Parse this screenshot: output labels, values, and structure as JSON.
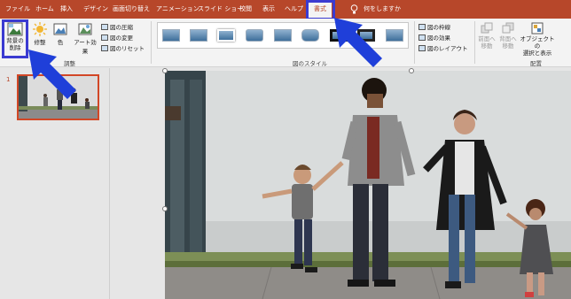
{
  "tabs": [
    {
      "label": "ファイル"
    },
    {
      "label": "ホーム"
    },
    {
      "label": "挿入"
    },
    {
      "label": "デザイン"
    },
    {
      "label": "画面切り替え"
    },
    {
      "label": "アニメーション"
    },
    {
      "label": "スライド ショー"
    },
    {
      "label": "校閲"
    },
    {
      "label": "表示"
    },
    {
      "label": "ヘルプ"
    },
    {
      "label": "書式"
    }
  ],
  "tell_me": "何をしますか",
  "ribbon": {
    "remove_bg": "背景の\n削除",
    "corrections": "修整",
    "color": "色",
    "artistic": "アート効果",
    "compress": "図の圧縮",
    "change": "図の変更",
    "reset": "図のリセット",
    "adjust_group": "調整",
    "styles_group": "図のスタイル",
    "border": "図の枠線",
    "effects": "図の効果",
    "layout": "図のレイアウト",
    "bring_forward": "前面へ\n移動",
    "send_backward": "背面へ\n移動",
    "selection_pane": "オブジェクトの\n選択と表示",
    "arrange_group": "配置"
  },
  "slide": {
    "number": "1"
  },
  "colors": {
    "accent": "#b7472a",
    "highlight": "#3b3bd1",
    "arrow": "#1f3fd9"
  }
}
